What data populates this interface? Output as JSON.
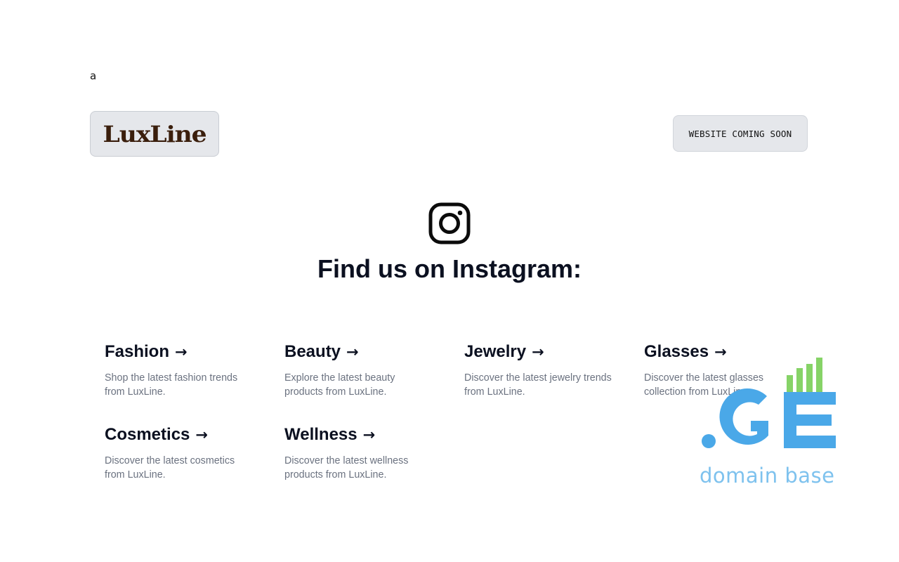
{
  "stray_text": "a",
  "header": {
    "logo_text": "LuxLine",
    "coming_soon_label": "WEBSITE COMING SOON"
  },
  "instagram": {
    "icon": "instagram-icon",
    "headline": "Find us on Instagram:"
  },
  "categories": [
    {
      "title": "Fashion",
      "arrow": "→",
      "description": "Shop the latest fashion trends from LuxLine."
    },
    {
      "title": "Beauty",
      "arrow": "→",
      "description": "Explore the latest beauty products from LuxLine."
    },
    {
      "title": "Jewelry",
      "arrow": "→",
      "description": "Discover the latest jewelry trends from LuxLine."
    },
    {
      "title": "Glasses",
      "arrow": "→",
      "description": "Discover the latest glasses collection from LuxLine."
    },
    {
      "title": "Cosmetics",
      "arrow": "→",
      "description": "Discover the latest cosmetics from LuxLine."
    },
    {
      "title": "Wellness",
      "arrow": "→",
      "description": "Discover the latest wellness products from LuxLine."
    }
  ],
  "watermark": {
    "logo_text": ".GE",
    "caption": "domain base",
    "colors": {
      "blue": "#4aa8e8",
      "green": "#7ccf5a"
    }
  },
  "colors": {
    "logo_brown": "#3a1e0c",
    "button_bg": "#e5e7eb",
    "heading": "#0b1020",
    "muted_text": "#6b7280"
  }
}
